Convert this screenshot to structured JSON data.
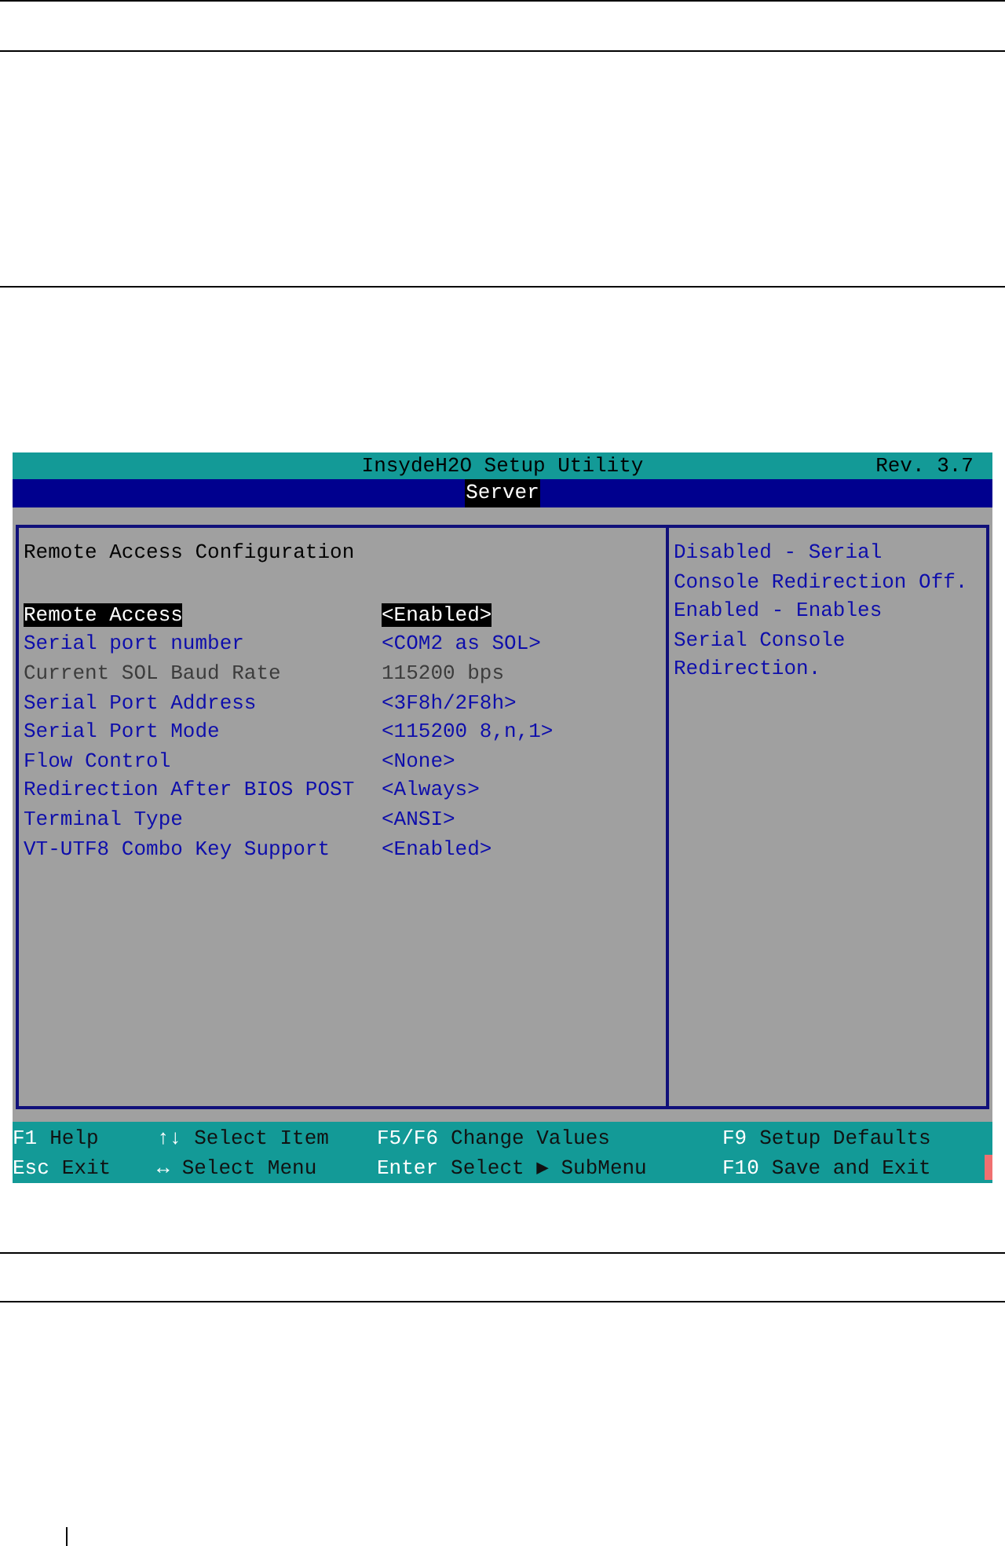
{
  "setup_window": {
    "title": "InsydeH2O Setup Utility",
    "revision": "Rev. 3.7",
    "tabs": [
      {
        "label": "Server",
        "selected": true
      }
    ],
    "section_title": "Remote Access Configuration",
    "settings": [
      {
        "label": "Remote Access",
        "value": "<Enabled>",
        "selected": true,
        "disabled": false
      },
      {
        "label": "Serial port number",
        "value": "<COM2 as SOL>",
        "selected": false,
        "disabled": false
      },
      {
        "label": "Current SOL Baud Rate",
        "value": "115200 bps",
        "selected": false,
        "disabled": true
      },
      {
        "label": "Serial Port Address",
        "value": "<3F8h/2F8h>",
        "selected": false,
        "disabled": false
      },
      {
        "label": "Serial Port Mode",
        "value": "<115200 8,n,1>",
        "selected": false,
        "disabled": false
      },
      {
        "label": "Flow Control",
        "value": "<None>",
        "selected": false,
        "disabled": false
      },
      {
        "label": "Redirection After BIOS POST",
        "value": "<Always>",
        "selected": false,
        "disabled": false
      },
      {
        "label": "Terminal Type",
        "value": "<ANSI>",
        "selected": false,
        "disabled": false
      },
      {
        "label": "VT-UTF8 Combo Key Support",
        "value": "<Enabled>",
        "selected": false,
        "disabled": false
      }
    ],
    "help_lines": [
      "Disabled - Serial",
      "Console Redirection Off.",
      "Enabled - Enables",
      "Serial Console",
      "Redirection."
    ],
    "key_legend": [
      [
        {
          "key": "F1",
          "action": "Help"
        },
        {
          "key": "↑↓",
          "action": "Select Item"
        },
        {
          "key": "F5/F6",
          "action": "Change Values"
        },
        {
          "key": "F9",
          "action": "Setup Defaults"
        }
      ],
      [
        {
          "key": "Esc",
          "action": "Exit"
        },
        {
          "key": "↔",
          "action": "Select Menu"
        },
        {
          "key": "Enter",
          "action": "Select ▶ SubMenu"
        },
        {
          "key": "F10",
          "action": "Save and Exit"
        }
      ]
    ]
  }
}
